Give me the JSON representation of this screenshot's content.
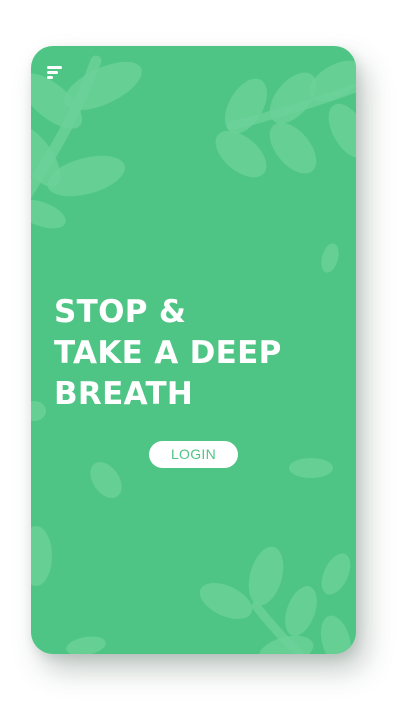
{
  "screen": {
    "headline_lines": [
      "STOP &",
      "TAKE A DEEP",
      "BREATH"
    ],
    "login_label": "LOGIN"
  },
  "icons": {
    "menu": "menu-icon"
  },
  "colors": {
    "card_background": "#4fc585",
    "leaf_decoration": "#6cd199",
    "text": "#ffffff",
    "button_background": "#ffffff",
    "button_text": "#4fc585"
  }
}
